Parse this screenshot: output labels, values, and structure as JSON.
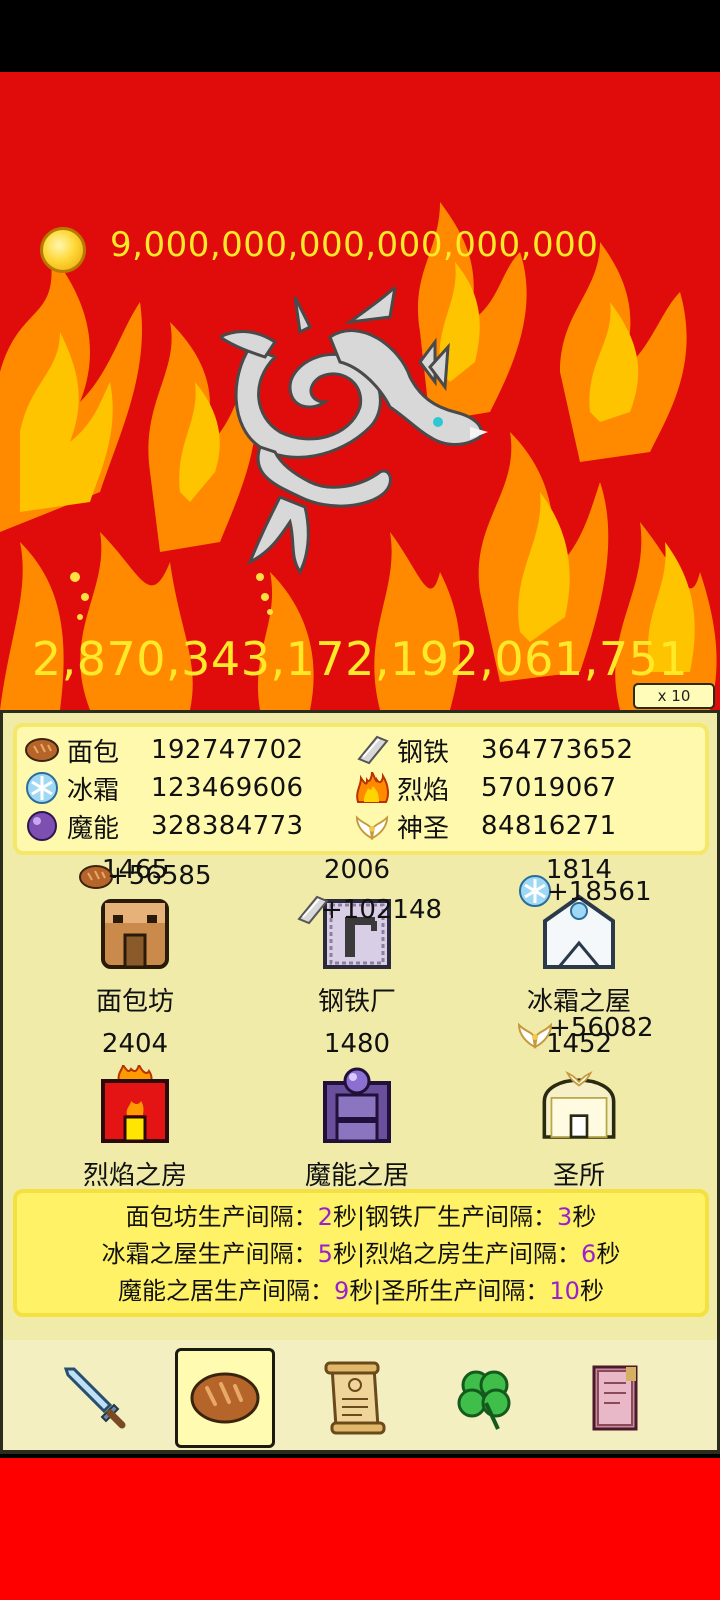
{
  "header": {
    "coin_amount": "9,000,000,000,000,000,000",
    "damage_value": "2,870,343,172,192,061,751",
    "multiplier_label": "x 10"
  },
  "resources": [
    {
      "name": "面包",
      "value": "192747702",
      "icon": "bread-icon"
    },
    {
      "name": "钢铁",
      "value": "364773652",
      "icon": "steel-ingot-icon"
    },
    {
      "name": "冰霜",
      "value": "123469606",
      "icon": "snowflake-icon"
    },
    {
      "name": "烈焰",
      "value": "57019067",
      "icon": "flame-icon"
    },
    {
      "name": "魔能",
      "value": "328384773",
      "icon": "magic-orb-icon"
    },
    {
      "name": "神圣",
      "value": "84816271",
      "icon": "angel-wings-icon"
    }
  ],
  "buildings": [
    {
      "name": "面包坊",
      "count": "1465",
      "float": "+56585"
    },
    {
      "name": "钢铁厂",
      "count": "2006",
      "float": "+102148"
    },
    {
      "name": "冰霜之屋",
      "count": "1814",
      "float": "+18561"
    },
    {
      "name": "烈焰之房",
      "count": "2404",
      "float": ""
    },
    {
      "name": "魔能之居",
      "count": "1480",
      "float": ""
    },
    {
      "name": "圣所",
      "count": "1452",
      "float": "+56082"
    }
  ],
  "production": {
    "line1": [
      {
        "t": "面包坊生产间隔："
      },
      {
        "n": "2"
      },
      {
        "t": "秒|钢铁厂生产间隔："
      },
      {
        "n": "3"
      },
      {
        "t": "秒"
      }
    ],
    "line2": [
      {
        "t": "冰霜之屋生产间隔："
      },
      {
        "n": "5"
      },
      {
        "t": "秒|烈焰之房生产间隔："
      },
      {
        "n": "6"
      },
      {
        "t": "秒"
      }
    ],
    "line3": [
      {
        "t": "魔能之居生产间隔："
      },
      {
        "n": "9"
      },
      {
        "t": "秒|圣所生产间隔："
      },
      {
        "n": "10"
      },
      {
        "t": "秒"
      }
    ]
  },
  "nav": [
    {
      "icon": "sword-icon",
      "active": false
    },
    {
      "icon": "bread-icon",
      "active": true
    },
    {
      "icon": "scroll-icon",
      "active": false
    },
    {
      "icon": "clover-icon",
      "active": false
    },
    {
      "icon": "book-icon",
      "active": false
    }
  ],
  "colors": {
    "scene_bg": "#e00b0b",
    "gold_text": "#ffe928",
    "panel_bg": "#f0eba8",
    "number_highlight": "#9a1fd0",
    "bottom_bar": "#ff0000"
  }
}
